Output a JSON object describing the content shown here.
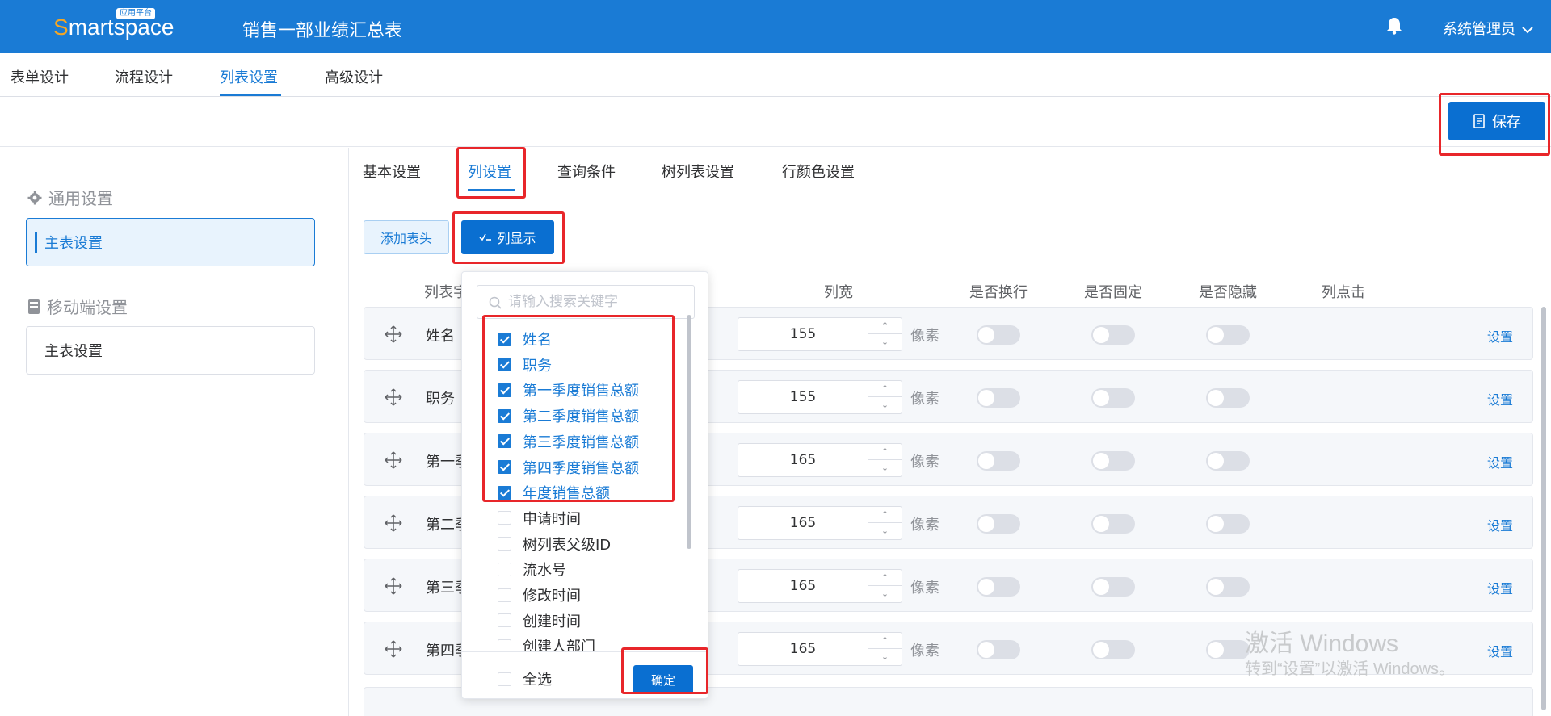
{
  "header": {
    "logo_text": "Smartspace",
    "logo_badge": "应用平台",
    "app_title": "销售一部业绩汇总表",
    "user": "系统管理员"
  },
  "nav": {
    "tabs": [
      "表单设计",
      "流程设计",
      "列表设置",
      "高级设计"
    ],
    "active": "列表设置"
  },
  "toolbar": {
    "save_label": "保存"
  },
  "sidebar": {
    "general": {
      "title": "通用设置",
      "item": "主表设置"
    },
    "mobile": {
      "title": "移动端设置",
      "item": "主表设置"
    }
  },
  "subtabs": {
    "items": [
      "基本设置",
      "列设置",
      "查询条件",
      "树列表设置",
      "行颜色设置"
    ],
    "active": "列设置"
  },
  "actions": {
    "add_header": "添加表头",
    "column_display": "列显示"
  },
  "table": {
    "headers": [
      "列表字",
      "列宽",
      "是否换行",
      "是否固定",
      "是否隐藏",
      "列点击"
    ],
    "unit": "像素",
    "link": "设置",
    "rows": [
      {
        "name": "姓名",
        "width": "155"
      },
      {
        "name": "职务",
        "width": "155"
      },
      {
        "name": "第一季",
        "width": "165"
      },
      {
        "name": "第二季",
        "width": "165"
      },
      {
        "name": "第三季",
        "width": "165"
      },
      {
        "name": "第四季",
        "width": "165"
      }
    ]
  },
  "column_picker": {
    "search_placeholder": "请输入搜索关键字",
    "items": [
      {
        "label": "姓名",
        "checked": true
      },
      {
        "label": "职务",
        "checked": true
      },
      {
        "label": "第一季度销售总额",
        "checked": true
      },
      {
        "label": "第二季度销售总额",
        "checked": true
      },
      {
        "label": "第三季度销售总额",
        "checked": true
      },
      {
        "label": "第四季度销售总额",
        "checked": true
      },
      {
        "label": "年度销售总额",
        "checked": true
      },
      {
        "label": "申请时间",
        "checked": false
      },
      {
        "label": "树列表父级ID",
        "checked": false
      },
      {
        "label": "流水号",
        "checked": false
      },
      {
        "label": "修改时间",
        "checked": false
      },
      {
        "label": "创建时间",
        "checked": false
      },
      {
        "label": "创建人部门",
        "checked": false
      }
    ],
    "select_all": "全选",
    "confirm": "确定"
  },
  "watermark": {
    "line1": "激活 Windows",
    "line2": "转到“设置”以激活 Windows。"
  },
  "colors": {
    "primary": "#1a7bd5",
    "highlight_box": "#e8262a"
  }
}
